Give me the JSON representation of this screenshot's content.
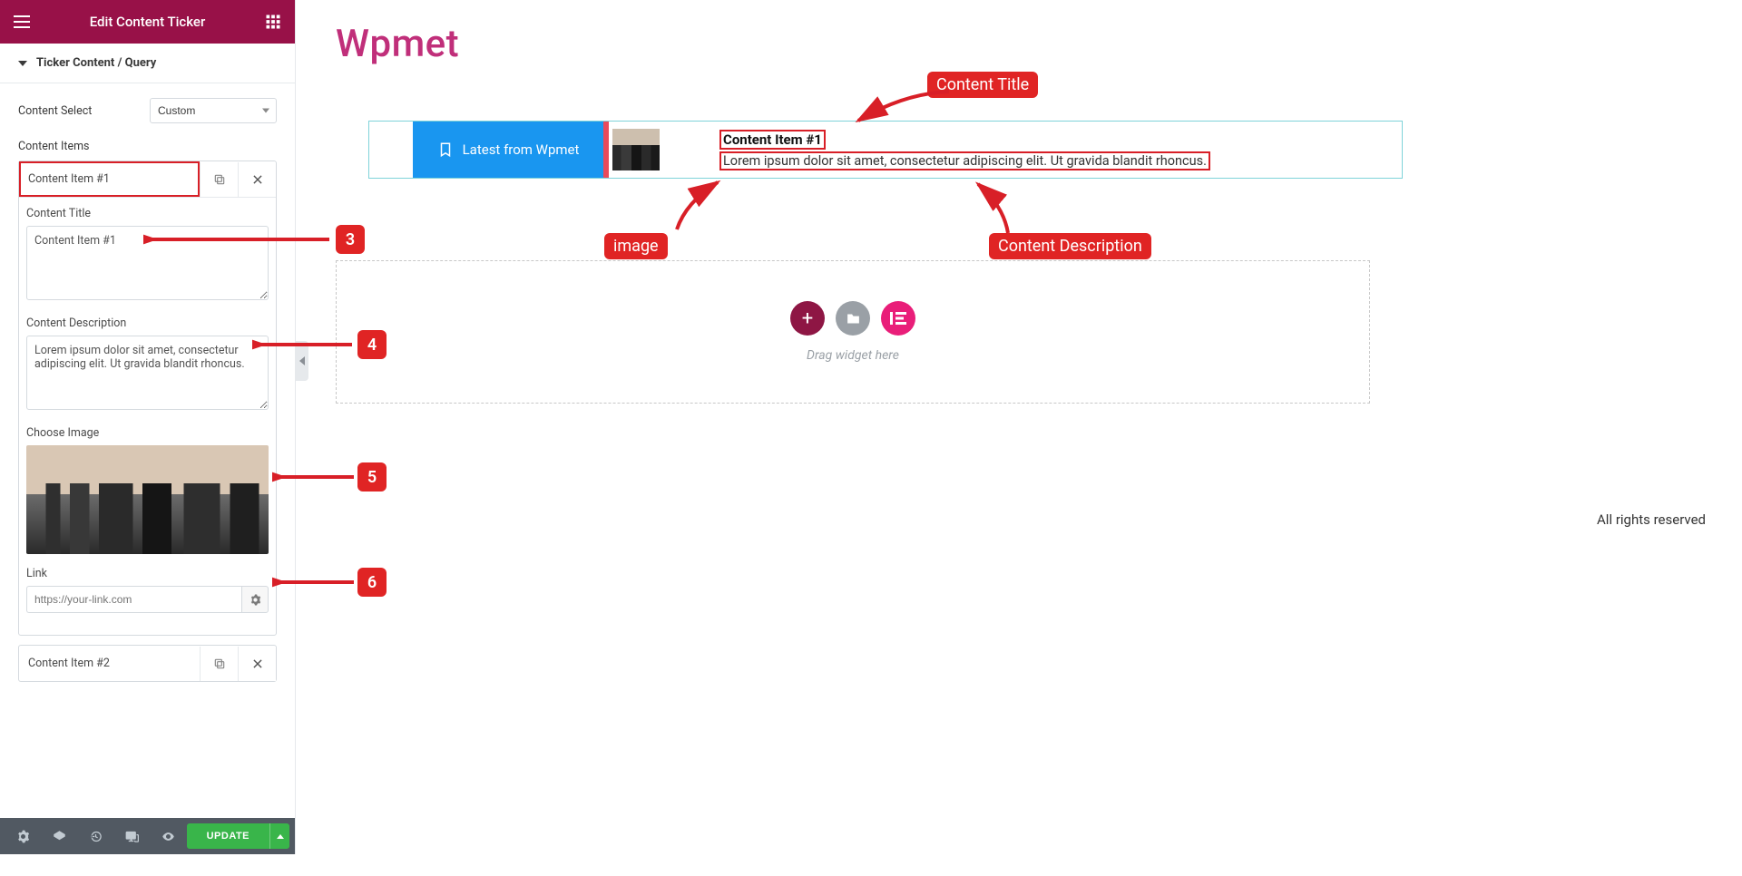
{
  "panel": {
    "header_title": "Edit Content Ticker",
    "section": "Ticker Content / Query",
    "content_select_label": "Content Select",
    "content_select_value": "Custom",
    "content_items_label": "Content Items",
    "items": [
      {
        "title": "Content Item #1",
        "fields": {
          "title_label": "Content Title",
          "title_value": "Content Item #1",
          "desc_label": "Content Description",
          "desc_value": "Lorem ipsum dolor sit amet, consectetur adipiscing elit. Ut gravida blandit rhoncus.",
          "image_label": "Choose Image",
          "link_label": "Link",
          "link_placeholder": "https://your-link.com"
        }
      },
      {
        "title": "Content Item #2"
      }
    ],
    "footer": {
      "update": "UPDATE"
    }
  },
  "canvas": {
    "brand": "Wpmet",
    "ticker_label": "Latest from Wpmet",
    "ticker_title": "Content Item #1",
    "ticker_desc": "Lorem ipsum dolor sit amet, consectetur adipiscing elit. Ut gravida blandit rhoncus.",
    "drop_text": "Drag widget here",
    "footer_text": "All rights reserved"
  },
  "annotations": {
    "content_title": "Content Title",
    "image": "image",
    "content_description": "Content Description",
    "n3": "3",
    "n4": "4",
    "n5": "5",
    "n6": "6"
  }
}
